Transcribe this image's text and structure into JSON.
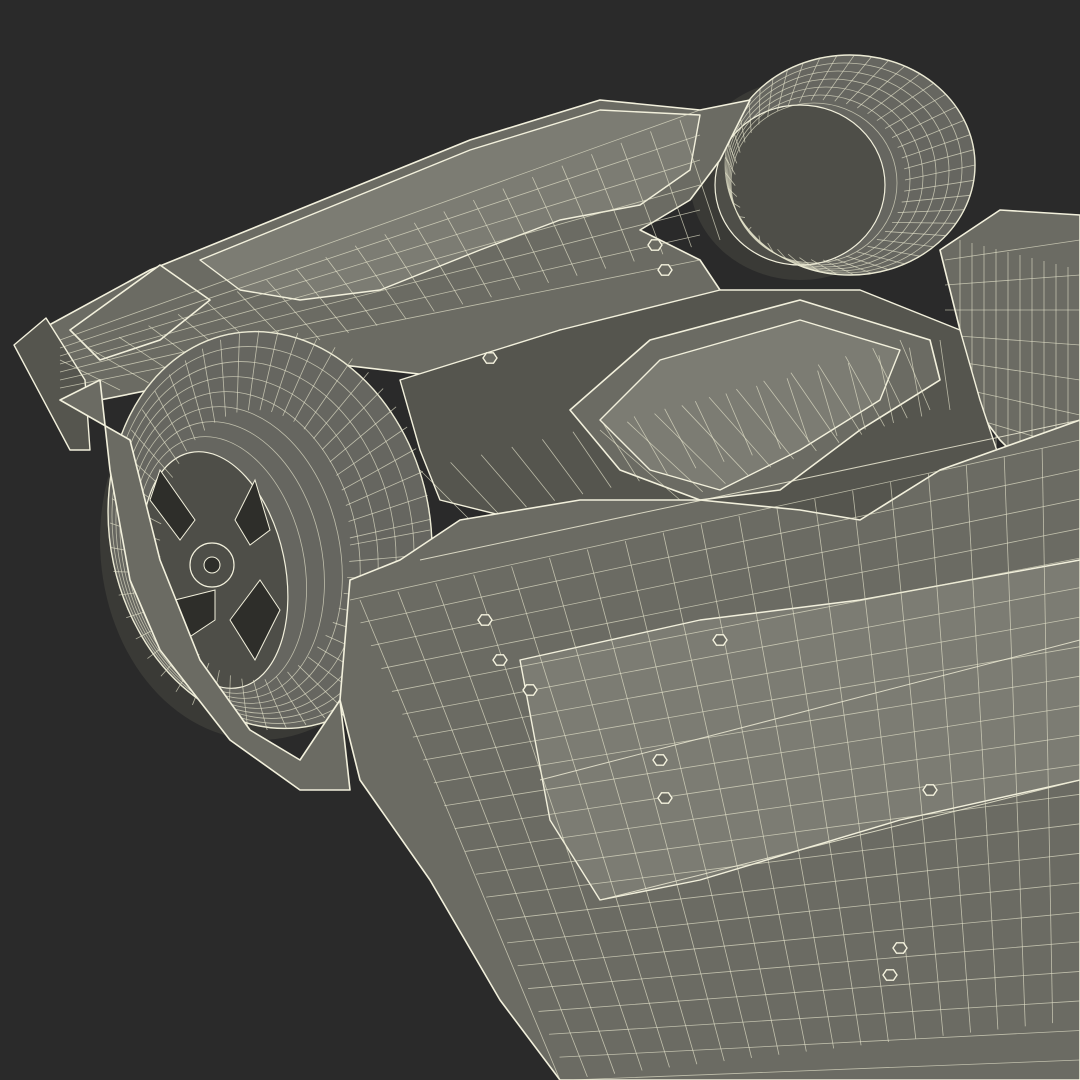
{
  "scene": {
    "subject": "car-undercarriage-wireframe-render",
    "background_color": "#2a2a2a",
    "mesh_fill_color": "#6b6b63",
    "wire_color": "#f2f0dc"
  }
}
